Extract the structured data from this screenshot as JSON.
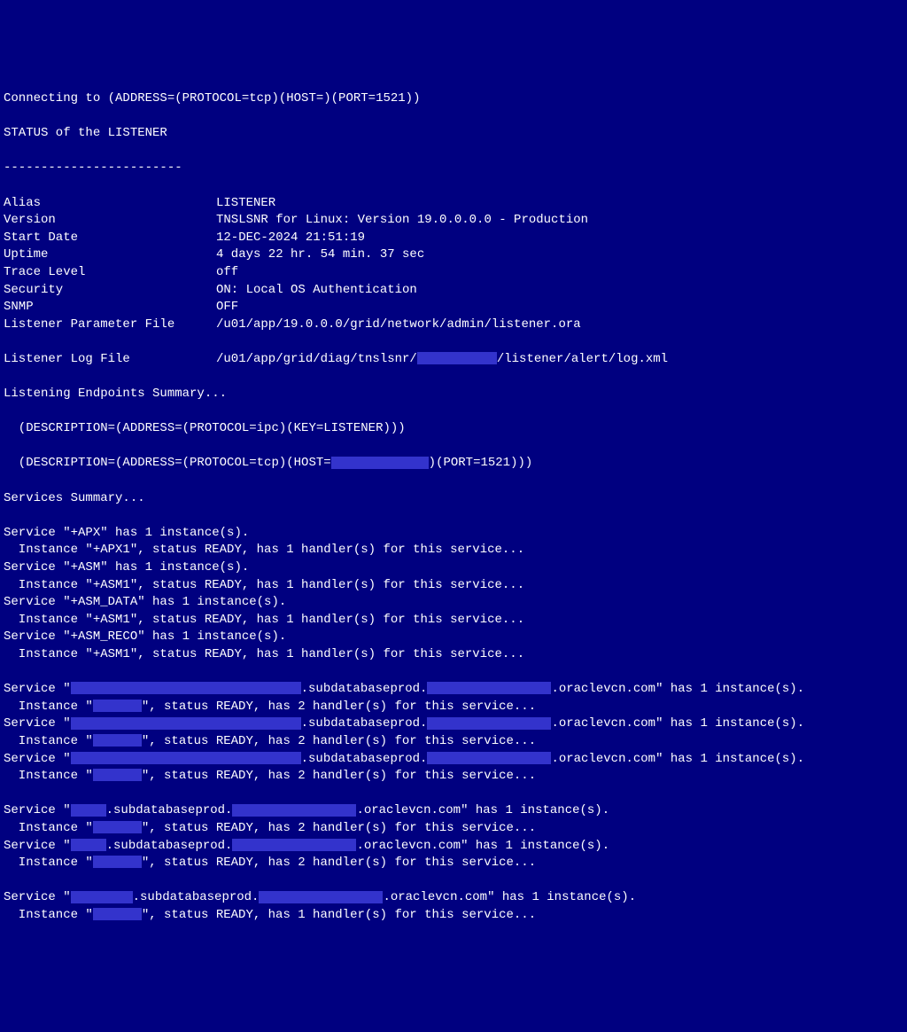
{
  "header": {
    "connecting": "Connecting to (ADDRESS=(PROTOCOL=tcp)(HOST=)(PORT=1521))",
    "status_line": "STATUS of the LISTENER",
    "divider": "------------------------"
  },
  "status": [
    {
      "key": "Alias",
      "value": "LISTENER"
    },
    {
      "key": "Version",
      "value": "TNSLSNR for Linux: Version 19.0.0.0.0 - Production"
    },
    {
      "key": "Start Date",
      "value": "12-DEC-2024 21:51:19"
    },
    {
      "key": "Uptime",
      "value": "4 days 22 hr. 54 min. 37 sec"
    },
    {
      "key": "Trace Level",
      "value": "off"
    },
    {
      "key": "Security",
      "value": "ON: Local OS Authentication"
    },
    {
      "key": "SNMP",
      "value": "OFF"
    },
    {
      "key": "Listener Parameter File",
      "value": "/u01/app/19.0.0.0/grid/network/admin/listener.ora"
    }
  ],
  "log_file": {
    "key": "Listener Log File",
    "prefix": "/u01/app/grid/diag/tnslsnr/",
    "suffix": "/listener/alert/log.xml"
  },
  "endpoints": {
    "title": "Listening Endpoints Summary...",
    "desc1": "  (DESCRIPTION=(ADDRESS=(PROTOCOL=ipc)(KEY=LISTENER)))",
    "desc2_prefix": "  (DESCRIPTION=(ADDRESS=(PROTOCOL=tcp)(HOST=",
    "desc2_suffix": ")(PORT=1521)))"
  },
  "services_summary": "Services Summary...",
  "named_services": [
    {
      "service_line": "Service \"+APX\" has 1 instance(s).",
      "instance_line": "  Instance \"+APX1\", status READY, has 1 handler(s) for this service..."
    },
    {
      "service_line": "Service \"+ASM\" has 1 instance(s).",
      "instance_line": "  Instance \"+ASM1\", status READY, has 1 handler(s) for this service..."
    },
    {
      "service_line": "Service \"+ASM_DATA\" has 1 instance(s).",
      "instance_line": "  Instance \"+ASM1\", status READY, has 1 handler(s) for this service..."
    },
    {
      "service_line": "Service \"+ASM_RECO\" has 1 instance(s).",
      "instance_line": "  Instance \"+ASM1\", status READY, has 1 handler(s) for this service..."
    }
  ],
  "redacted_long_services": [
    {
      "svc_prefix": "Service \"",
      "svc_mid1": ".subdatabaseprod.",
      "svc_mid2": ".oraclevcn.com\" has 1 instance(s).",
      "inst_prefix": "  Instance \"",
      "inst_suffix": "\", status READY, has 2 handler(s) for this service..."
    },
    {
      "svc_prefix": "Service \"",
      "svc_mid1": ".subdatabaseprod.",
      "svc_mid2": ".oraclevcn.com\" has 1 instance(s).",
      "inst_prefix": "  Instance \"",
      "inst_suffix": "\", status READY, has 2 handler(s) for this service..."
    },
    {
      "svc_prefix": "Service \"",
      "svc_mid1": ".subdatabaseprod.",
      "svc_mid2": ".oraclevcn.com\" has 1 instance(s).",
      "inst_prefix": "  Instance \"",
      "inst_suffix": "\", status READY, has 2 handler(s) for this service..."
    }
  ],
  "redacted_short_services": [
    {
      "svc_prefix": "Service \"",
      "svc_mid1": ".subdatabaseprod.",
      "svc_mid2": ".oraclevcn.com\" has 1 instance(s).",
      "inst_prefix": "  Instance \"",
      "inst_suffix": "\", status READY, has 2 handler(s) for this service..."
    },
    {
      "svc_prefix": "Service \"",
      "svc_mid1": ".subdatabaseprod.",
      "svc_mid2": ".oraclevcn.com\" has 1 instance(s).",
      "inst_prefix": "  Instance \"",
      "inst_suffix": "\", status READY, has 2 handler(s) for this service..."
    }
  ],
  "redacted_final_service": {
    "svc_prefix": "Service \"",
    "svc_mid1": ".subdatabaseprod.",
    "svc_mid2": ".oraclevcn.com\" has 1 instance(s).",
    "inst_prefix": "  Instance \"",
    "inst_suffix": "\", status READY, has 1 handler(s) for this service..."
  },
  "redact_widths": {
    "log_host": 90,
    "tcp_host": 110,
    "long_svc_name": 260,
    "long_svc_domain": 140,
    "short_svc_prefix": 40,
    "short_svc_domain": 140,
    "final_svc_prefix": 70,
    "final_svc_domain": 140,
    "instance_name": 55
  }
}
